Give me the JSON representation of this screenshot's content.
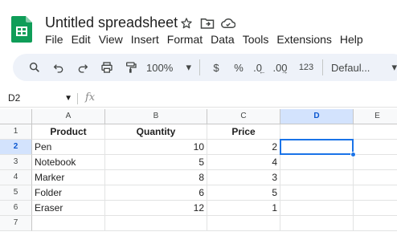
{
  "document": {
    "title": "Untitled spreadsheet"
  },
  "menu": [
    "File",
    "Edit",
    "View",
    "Insert",
    "Format",
    "Data",
    "Tools",
    "Extensions",
    "Help"
  ],
  "toolbar": {
    "zoom": "100%",
    "currency": "$",
    "percent": "%",
    "decrease_decimal": ".0",
    "increase_decimal": ".00",
    "more_formats": "123",
    "font": "Defaul..."
  },
  "formula_bar": {
    "name_box": "D2",
    "fx_label": "fx",
    "value": ""
  },
  "sheet": {
    "columns": [
      "A",
      "B",
      "C",
      "D",
      "E"
    ],
    "rows": [
      "1",
      "2",
      "3",
      "4",
      "5",
      "6",
      "7"
    ],
    "header": [
      "Product",
      "Quantity",
      "Price"
    ],
    "data": [
      [
        "Pen",
        "10",
        "2"
      ],
      [
        "Notebook",
        "5",
        "4"
      ],
      [
        "Marker",
        "8",
        "3"
      ],
      [
        "Folder",
        "6",
        "5"
      ],
      [
        "Eraser",
        "12",
        "1"
      ]
    ],
    "selected_cell": "D2"
  },
  "colors": {
    "accent": "#1a73e8",
    "header_bg": "#f8f9fa",
    "selected_header_bg": "#d3e3fd",
    "toolbar_bg": "#eef2f9",
    "logo_green": "#0f9d58"
  }
}
